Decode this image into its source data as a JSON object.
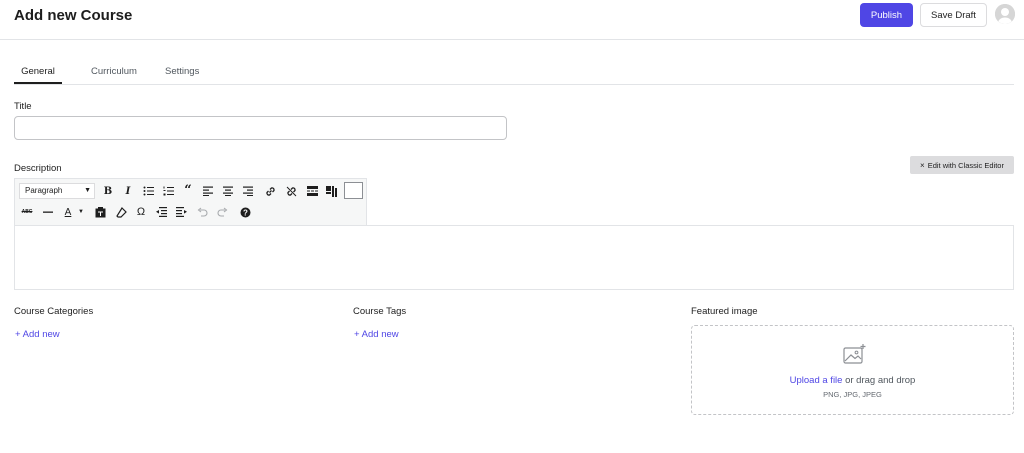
{
  "header": {
    "title": "Add new Course",
    "publish_label": "Publish",
    "save_draft_label": "Save Draft"
  },
  "tabs": [
    {
      "label": "General",
      "active": true
    },
    {
      "label": "Curriculum",
      "active": false
    },
    {
      "label": "Settings",
      "active": false
    }
  ],
  "title_field": {
    "label": "Title",
    "value": "",
    "placeholder": ""
  },
  "description": {
    "label": "Description",
    "classic_editor_label": "Edit with Classic Editor",
    "format_select": "Paragraph",
    "toolbar_row1": [
      "bold-icon",
      "italic-icon",
      "bullet-list-icon",
      "numbered-list-icon",
      "blockquote-icon",
      "align-left-icon",
      "align-center-icon",
      "align-right-icon",
      "link-icon",
      "unlink-icon",
      "read-more-icon",
      "toolbar-toggle-icon"
    ],
    "toolbar_row2": [
      "strikethrough-icon",
      "horizontal-line-icon",
      "text-color-icon",
      "paste-text-icon",
      "clear-formatting-icon",
      "special-character-icon",
      "outdent-icon",
      "indent-icon",
      "undo-icon",
      "redo-icon",
      "help-icon"
    ],
    "value": ""
  },
  "categories": {
    "label": "Course Categories",
    "add_label": "Add new"
  },
  "tags": {
    "label": "Course Tags",
    "add_label": "Add new"
  },
  "featured_image": {
    "label": "Featured image",
    "upload_link": "Upload a file",
    "upload_rest": " or drag and drop",
    "formats": "PNG, JPG, JPEG"
  },
  "colors": {
    "accent": "#4f46e5",
    "border": "#e2e4e7",
    "toolbar_bg": "#f6f7f7"
  }
}
